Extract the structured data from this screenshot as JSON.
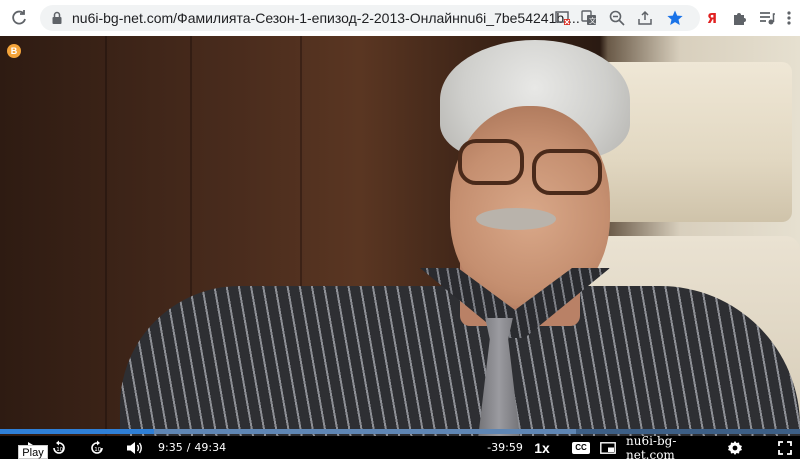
{
  "browser": {
    "url": "nu6i-bg-net.com/Фамилията-Сезон-1-епизод-2-2013-Онлайнnu6i_7be54241b....",
    "extensions": [
      "blocked-popup-icon",
      "translate-icon",
      "zoom-out-icon",
      "share-icon",
      "bookmark-star-icon",
      "yandex-icon",
      "puzzle-extensions-icon",
      "playlist-icon"
    ],
    "accent_color": "#1a73e8"
  },
  "video": {
    "badge_text": "B"
  },
  "player": {
    "tooltip": "Play",
    "current_time": "9:35",
    "separator": "/",
    "duration": "49:34",
    "remaining": "-39:59",
    "speed": "1x",
    "cc_label": "CC",
    "brand": "nu6i-bg-net.com",
    "progress_fraction": 0.193,
    "buffer_fraction": 0.72
  }
}
